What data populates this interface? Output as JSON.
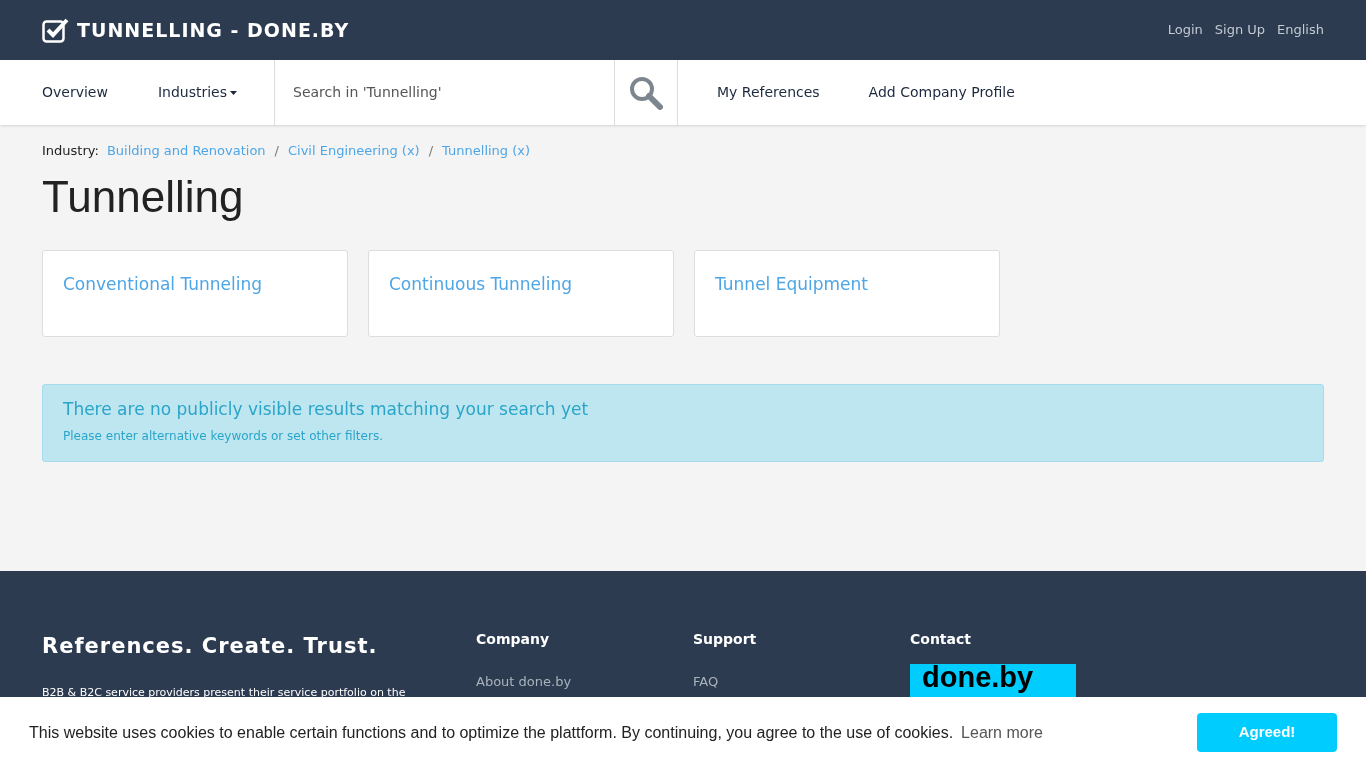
{
  "header": {
    "brand": "TUNNELLING - DONE.BY",
    "links": [
      "Login",
      "Sign Up",
      "English"
    ]
  },
  "nav": {
    "items": [
      {
        "label": "Overview",
        "kind": "link"
      },
      {
        "label": "Industries",
        "kind": "dropdown"
      }
    ],
    "search": {
      "placeholder": "Search in 'Tunnelling'"
    },
    "links": [
      "My References",
      "Add Company Profile"
    ]
  },
  "breadcrumb": {
    "label": "Industry:",
    "separator": "/",
    "items": [
      "Building and Renovation",
      "Civil Engineering (x)",
      "Tunnelling (x)"
    ]
  },
  "title": "Tunnelling",
  "categories": [
    "Conventional Tunneling",
    "Continuous Tunneling",
    "Tunnel Equipment"
  ],
  "alert": {
    "heading": "There are no publicly visible results matching your search yet",
    "text": "Please enter alternative keywords or set other filters."
  },
  "footer": {
    "tagline": "References. Create. Trust.",
    "text": "B2B & B2C service providers present their service portfolio on the",
    "columns": [
      {
        "heading": "Company",
        "links": [
          "About done.by"
        ]
      },
      {
        "heading": "Support",
        "links": [
          "FAQ"
        ]
      },
      {
        "heading": "Contact",
        "logo": "done.by"
      }
    ]
  },
  "cookie_banner": {
    "text": "This website uses cookies to enable certain functions and to optimize the plattform. By continuing, you agree to the use of cookies.",
    "link": "Learn more",
    "button": "Agreed!"
  }
}
